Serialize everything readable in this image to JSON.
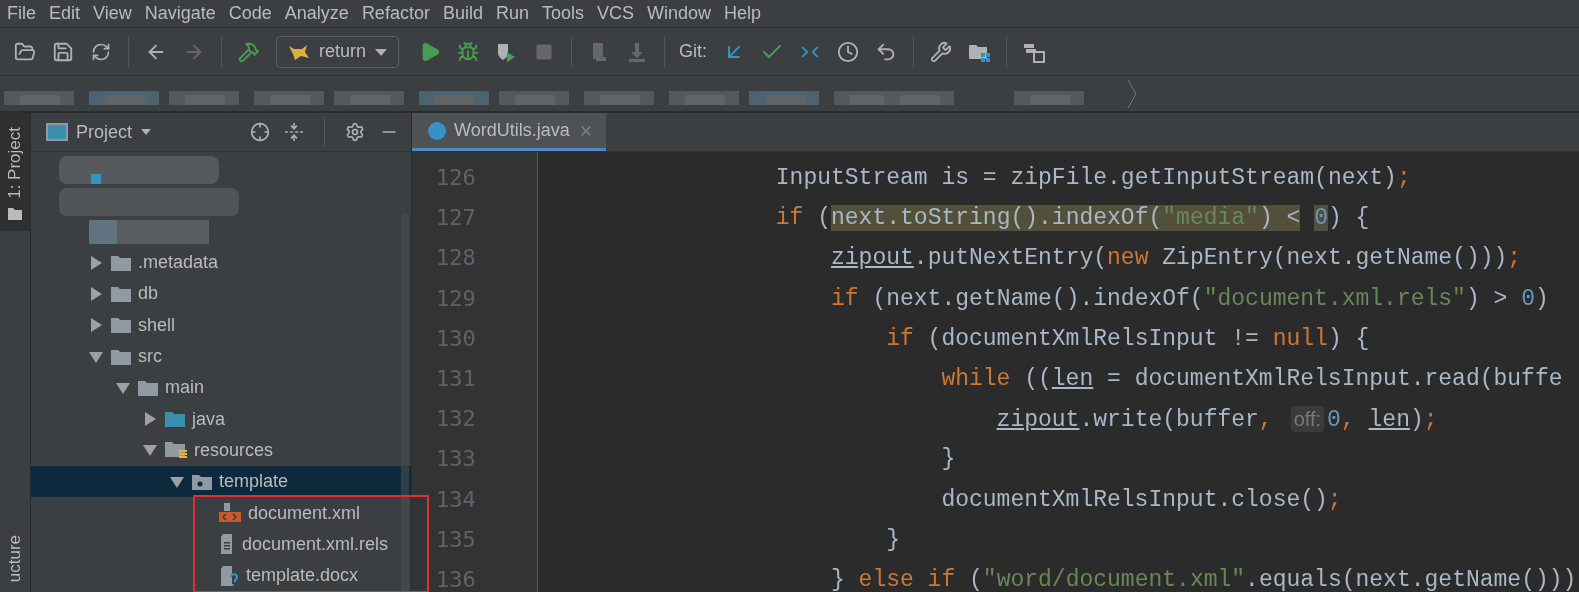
{
  "menu": [
    {
      "label": "File"
    },
    {
      "label": "Edit"
    },
    {
      "label": "View"
    },
    {
      "label": "Navigate"
    },
    {
      "label": "Code"
    },
    {
      "label": "Analyze"
    },
    {
      "label": "Refactor"
    },
    {
      "label": "Build"
    },
    {
      "label": "Run"
    },
    {
      "label": "Tools"
    },
    {
      "label": "VCS"
    },
    {
      "label": "Window"
    },
    {
      "label": "Help"
    }
  ],
  "toolbar": [
    {
      "kind": "button",
      "disabled": false
    },
    {
      "kind": "button",
      "disabled": false
    },
    {
      "kind": "button",
      "disabled": false
    },
    {
      "kind": "separator"
    },
    {
      "kind": "button",
      "disabled": false
    },
    {
      "kind": "button",
      "disabled": true
    },
    {
      "kind": "separator"
    },
    {
      "kind": "button",
      "disabled": false
    },
    {
      "kind": "run-config",
      "label": "return"
    },
    {
      "kind": "button",
      "disabled": false
    },
    {
      "kind": "button",
      "disabled": false
    },
    {
      "kind": "button",
      "disabled": false
    },
    {
      "kind": "button",
      "disabled": true
    },
    {
      "kind": "separator"
    },
    {
      "kind": "button",
      "disabled": true
    },
    {
      "kind": "button",
      "disabled": true
    },
    {
      "kind": "separator"
    },
    {
      "kind": "label",
      "label": "Git:"
    },
    {
      "kind": "button",
      "disabled": false
    },
    {
      "kind": "button",
      "disabled": false
    },
    {
      "kind": "button",
      "disabled": false
    },
    {
      "kind": "button",
      "disabled": false
    },
    {
      "kind": "button",
      "disabled": false
    },
    {
      "kind": "separator"
    },
    {
      "kind": "button",
      "disabled": false
    },
    {
      "kind": "button",
      "disabled": false
    },
    {
      "kind": "separator"
    },
    {
      "kind": "button",
      "disabled": false
    }
  ],
  "side_strip": {
    "top_tab": "1: Project",
    "bottom_tab": "ucture"
  },
  "project_panel": {
    "title": "Project",
    "tree": [
      {
        "label": ".metadata",
        "expanded": false,
        "selected": false,
        "kind": "folder"
      },
      {
        "label": "db",
        "expanded": false,
        "selected": false,
        "kind": "folder"
      },
      {
        "label": "shell",
        "expanded": false,
        "selected": false,
        "kind": "folder"
      },
      {
        "label": "src",
        "expanded": true,
        "selected": false,
        "kind": "folder",
        "children": [
          {
            "label": "main",
            "expanded": true,
            "selected": false,
            "kind": "folder",
            "children": [
              {
                "label": "java",
                "expanded": false,
                "selected": false,
                "kind": "source-folder"
              },
              {
                "label": "resources",
                "expanded": true,
                "selected": false,
                "kind": "resource-folder",
                "children": [
                  {
                    "label": "template",
                    "expanded": true,
                    "selected": true,
                    "kind": "package",
                    "children": [
                      {
                        "label": "document.xml",
                        "selected": false,
                        "kind": "xml-file"
                      },
                      {
                        "label": "document.xml.rels",
                        "selected": false,
                        "kind": "text-file"
                      },
                      {
                        "label": "template.docx",
                        "selected": false,
                        "kind": "unknown-file"
                      }
                    ]
                  }
                ]
              }
            ]
          }
        ]
      }
    ]
  },
  "editor": {
    "tabs": [
      {
        "label": "WordUtils.java",
        "selected": true
      }
    ],
    "lines": [
      {
        "number": "126",
        "tokens": [
          {
            "kind": "plain",
            "t": "InputStream is = zipFile.getInputStream(next)"
          },
          {
            "kind": "punct",
            "t": ";"
          }
        ]
      },
      {
        "number": "127",
        "tokens": [
          {
            "kind": "keyword",
            "t": "if"
          },
          {
            "kind": "plain",
            "t": "("
          },
          {
            "kind": "plain",
            "t": "next.toString().indexOf(",
            "marked": true
          },
          {
            "kind": "string",
            "t": "\"media\"",
            "marked": true
          },
          {
            "kind": "plain",
            "t": ") <",
            "marked": true
          },
          {
            "kind": "number",
            "t": "0",
            "marked": true
          },
          {
            "kind": "plain",
            "t": ") {"
          }
        ],
        "children": [
          {
            "number": "128",
            "tokens": [
              {
                "kind": "field",
                "t": "zipout"
              },
              {
                "kind": "plain",
                "t": ".putNextEntry("
              },
              {
                "kind": "keyword",
                "t": "new"
              },
              {
                "kind": "plain",
                "t": "ZipEntry(next.getName()))"
              },
              {
                "kind": "punct",
                "t": ";"
              }
            ]
          },
          {
            "number": "129",
            "tokens": [
              {
                "kind": "keyword",
                "t": "if"
              },
              {
                "kind": "plain",
                "t": "(next.getName().indexOf("
              },
              {
                "kind": "string",
                "t": "\"document.xml.rels\""
              },
              {
                "kind": "plain",
                "t": ") >"
              },
              {
                "kind": "number",
                "t": "0"
              },
              {
                "kind": "plain",
                "t": ")"
              }
            ],
            "children": [
              {
                "number": "130",
                "tokens": [
                  {
                    "kind": "keyword",
                    "t": "if"
                  },
                  {
                    "kind": "plain",
                    "t": "(documentXmlRelsInput !="
                  },
                  {
                    "kind": "keyword",
                    "t": "null"
                  },
                  {
                    "kind": "plain",
                    "t": ") {"
                  }
                ],
                "children": [
                  {
                    "number": "131",
                    "tokens": [
                      {
                        "kind": "keyword",
                        "t": "while"
                      },
                      {
                        "kind": "plain",
                        "t": "(("
                      },
                      {
                        "kind": "field",
                        "t": "len"
                      },
                      {
                        "kind": "plain",
                        "t": "= documentXmlRelsInput.read(buffe"
                      }
                    ],
                    "children": [
                      {
                        "number": "132",
                        "tokens": [
                          {
                            "kind": "field",
                            "t": "zipout"
                          },
                          {
                            "kind": "plain",
                            "t": ".write(buffer"
                          },
                          {
                            "kind": "punct",
                            "t": ","
                          },
                          {
                            "kind": "hint",
                            "t": "off:"
                          },
                          {
                            "kind": "number",
                            "t": "0"
                          },
                          {
                            "kind": "punct",
                            "t": ","
                          },
                          {
                            "kind": "field",
                            "t": "len"
                          },
                          {
                            "kind": "plain",
                            "t": ")"
                          },
                          {
                            "kind": "punct",
                            "t": ";"
                          }
                        ]
                      }
                    ]
                  },
                  {
                    "number": "133",
                    "tokens": [
                      {
                        "kind": "plain",
                        "t": "}"
                      }
                    ]
                  },
                  {
                    "number": "134",
                    "tokens": [
                      {
                        "kind": "plain",
                        "t": "documentXmlRelsInput.close()"
                      },
                      {
                        "kind": "punct",
                        "t": ";"
                      }
                    ]
                  }
                ]
              },
              {
                "number": "135",
                "tokens": [
                  {
                    "kind": "plain",
                    "t": "}"
                  }
                ]
              }
            ]
          },
          {
            "number": "136",
            "tokens": [
              {
                "kind": "plain",
                "t": "}"
              },
              {
                "kind": "keyword",
                "t": "else if"
              },
              {
                "kind": "plain",
                "t": "("
              },
              {
                "kind": "string",
                "t": "\"word/document.xml\""
              },
              {
                "kind": "plain",
                "t": ".equals(next.getName()))"
              }
            ]
          }
        ]
      }
    ]
  }
}
